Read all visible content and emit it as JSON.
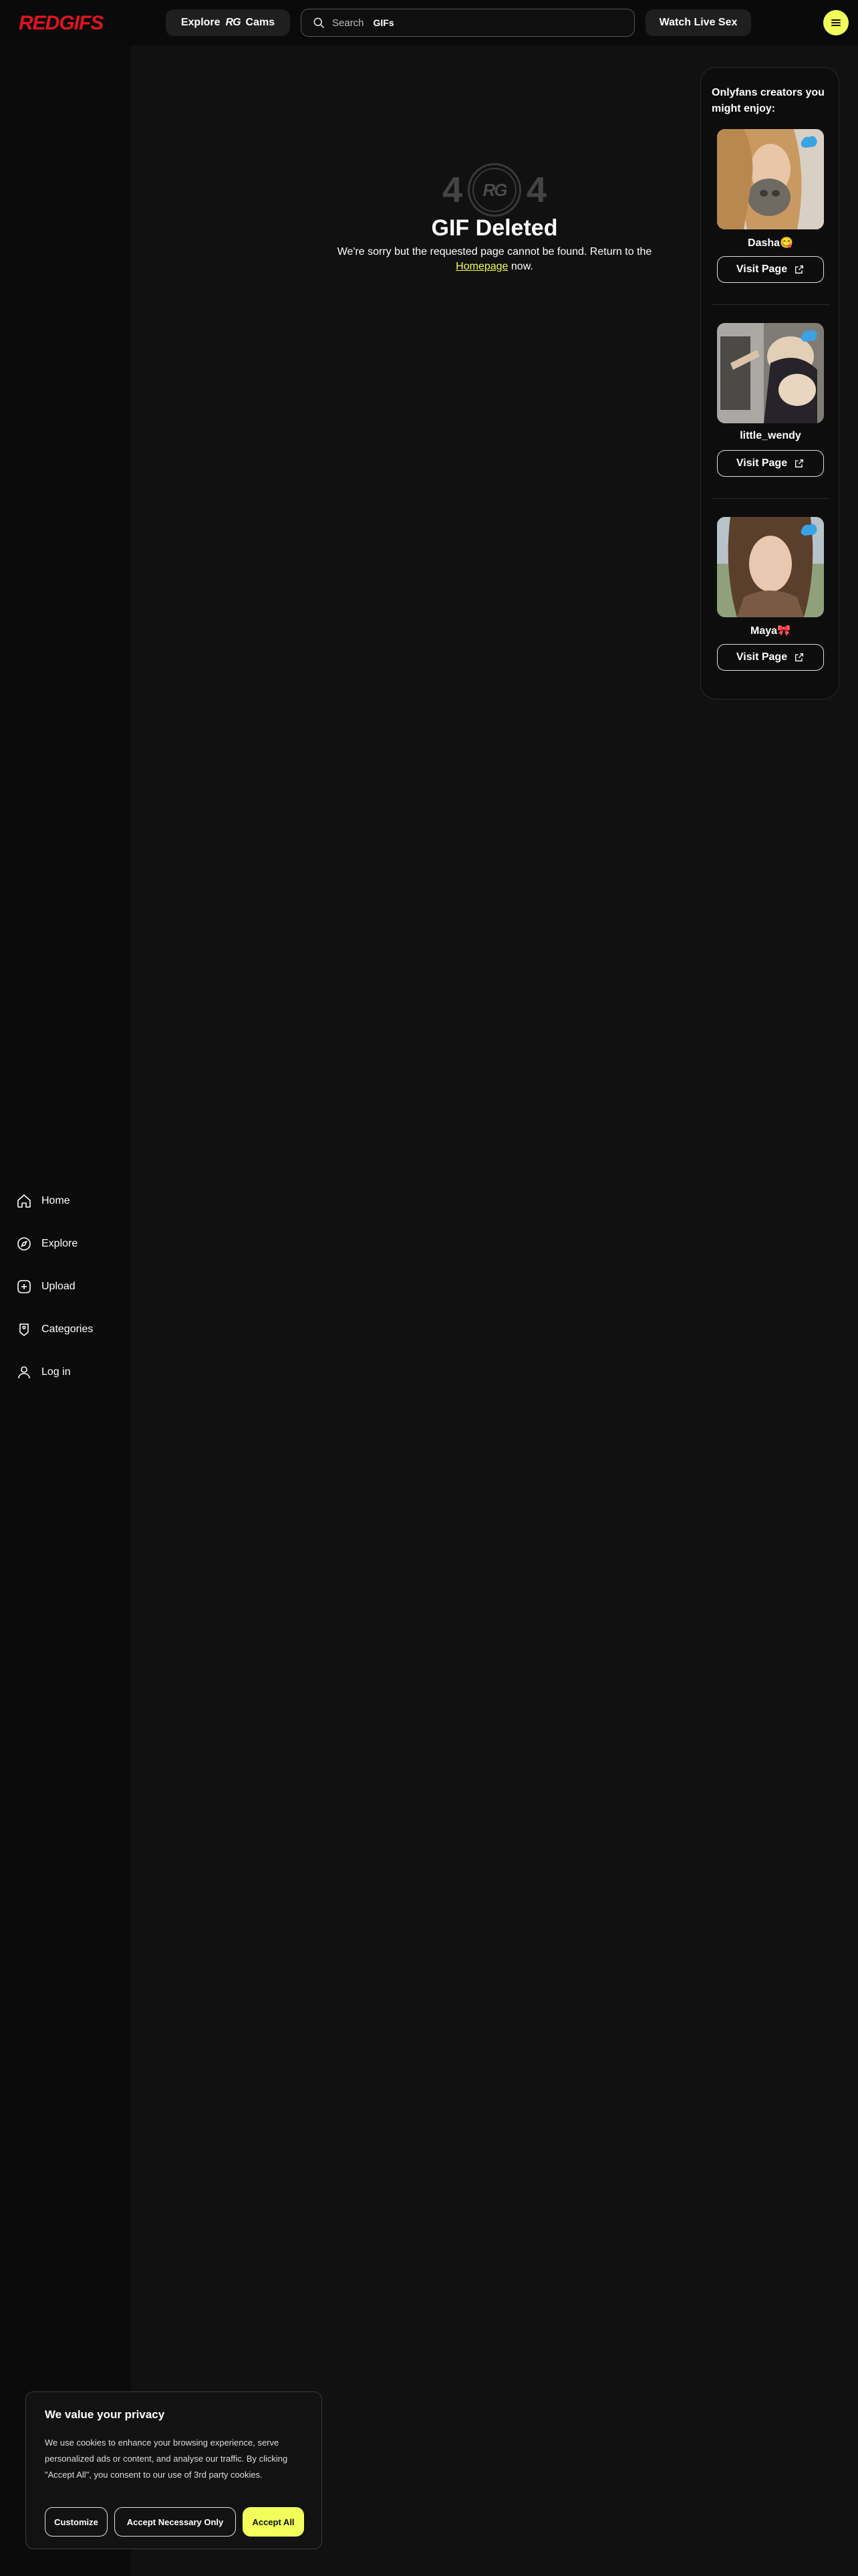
{
  "header": {
    "logo": "REDGIFS",
    "explore_label": "Explore",
    "explore_suffix": "Cams",
    "rg_mark": "RG",
    "search_placeholder": "Search",
    "search_value": "GIFs",
    "live_label": "Watch Live Sex"
  },
  "sidebar": {
    "items": [
      {
        "label": "Home",
        "icon": "home-icon"
      },
      {
        "label": "Explore",
        "icon": "compass-icon"
      },
      {
        "label": "Upload",
        "icon": "plus-square-icon"
      },
      {
        "label": "Categories",
        "icon": "tag-icon"
      },
      {
        "label": "Log in",
        "icon": "user-icon"
      }
    ]
  },
  "error": {
    "digit_left": "4",
    "digit_right": "4",
    "mark": "RG",
    "title": "GIF Deleted",
    "text_before": "We're sorry but the requested page cannot be found. Return to the",
    "link": "Homepage",
    "text_after": "now."
  },
  "creators": {
    "title": "Onlyfans creators you might enjoy:",
    "cards": [
      {
        "name": "Dasha😋",
        "button": "Visit Page"
      },
      {
        "name": "little_wendy",
        "button": "Visit Page"
      },
      {
        "name": "Maya🎀",
        "button": "Visit Page"
      }
    ]
  },
  "cookie": {
    "title": "We value your privacy",
    "text": "We use cookies to enhance your browsing experience, serve personalized ads or content, and analyse our traffic. By clicking \"Accept All\", you consent to our use of 3rd party cookies.",
    "customize": "Customize",
    "necessary": "Accept Necessary Only",
    "accept_all": "Accept All"
  },
  "colors": {
    "accent": "#f2ff5b",
    "brand": "#e0141e",
    "background": "#111111"
  }
}
